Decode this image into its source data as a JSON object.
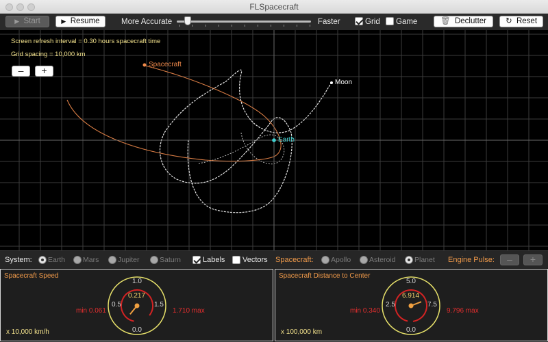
{
  "window": {
    "title": "FLSpacecraft"
  },
  "toolbar": {
    "start_label": "Start",
    "resume_label": "Resume",
    "more_accurate_label": "More Accurate",
    "faster_label": "Faster",
    "accuracy_level": 0.08,
    "grid": {
      "label": "Grid",
      "checked": true
    },
    "game": {
      "label": "Game",
      "checked": false
    },
    "declutter_label": "Declutter",
    "reset_label": "Reset"
  },
  "canvas": {
    "refresh_text": "Screen refresh interval = 0.30 hours spacecraft time",
    "grid_text": "Grid spacing = 10,000 km",
    "zoom_out_label": "–",
    "zoom_in_label": "+",
    "labels": {
      "spacecraft": "Spacecraft",
      "earth": "Earth",
      "moon": "Moon"
    },
    "colors": {
      "spacecraft": "#f08a4b",
      "earth": "#3fd0d0",
      "moon": "#ffffff",
      "grid": "#3c3c3c"
    }
  },
  "controls": {
    "system_label": "System:",
    "systems": [
      {
        "label": "Earth",
        "selected": true
      },
      {
        "label": "Mars",
        "selected": false
      },
      {
        "label": "Jupiter",
        "selected": false
      },
      {
        "label": "Saturn",
        "selected": false
      }
    ],
    "labels_checkbox": {
      "label": "Labels",
      "checked": true
    },
    "vectors_checkbox": {
      "label": "Vectors",
      "checked": false
    },
    "spacecraft_label": "Spacecraft:",
    "spacecraft_options": [
      {
        "label": "Apollo",
        "selected": false
      },
      {
        "label": "Asteroid",
        "selected": false
      },
      {
        "label": "Planet",
        "selected": true
      }
    ],
    "engine_pulse_label": "Engine Pulse:",
    "pulse_minus": "–",
    "pulse_plus": "+"
  },
  "speed_panel": {
    "title": "Spacecraft Speed",
    "unit": "x 10,000 km/h",
    "value": "0.217",
    "min_text": "min 0.061",
    "max_text": "1.710 max",
    "scale": {
      "top": "1.0",
      "left": "0.5",
      "right": "1.5",
      "bottom": "0.0"
    },
    "range": [
      0,
      2
    ],
    "current": 0.217,
    "min": 0.061,
    "max": 1.71
  },
  "distance_panel": {
    "title": "Spacecraft Distance to Center",
    "unit": "x 100,000 km",
    "value": "6.914",
    "min_text": "min 0.340",
    "max_text": "9.796 max",
    "scale": {
      "top": "5.0",
      "left": "2.5",
      "right": "7.5",
      "bottom": "0.0"
    },
    "range": [
      0,
      10
    ],
    "current": 6.914,
    "min": 0.34,
    "max": 9.796
  }
}
